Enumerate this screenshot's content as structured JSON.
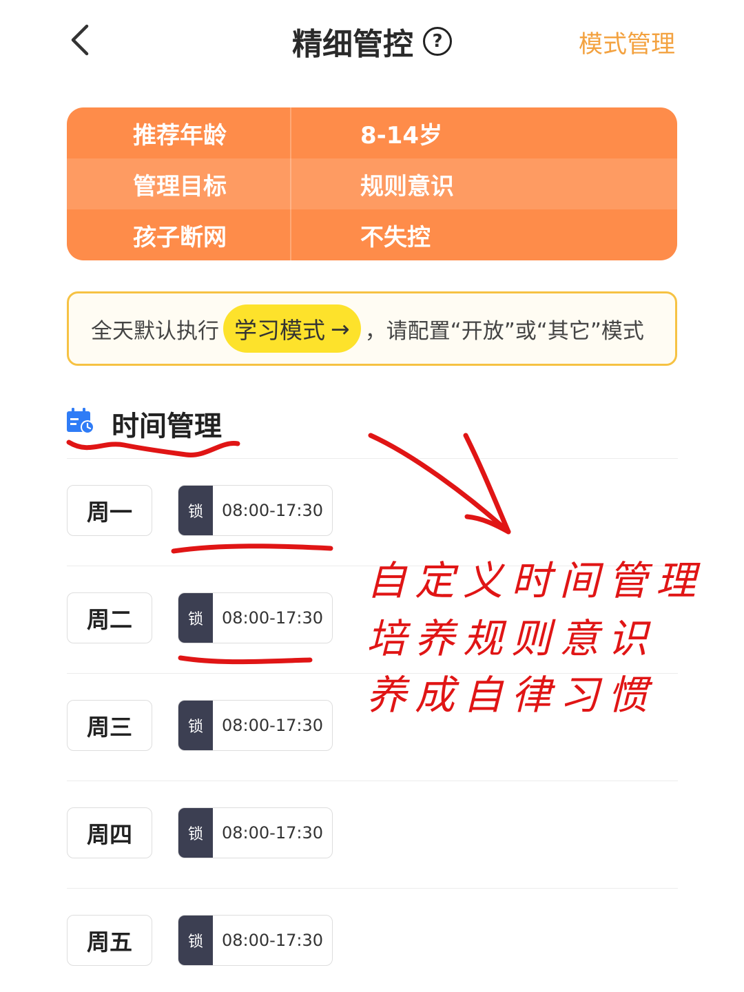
{
  "header": {
    "title": "精细管控",
    "help_glyph": "?",
    "action_label": "模式管理",
    "accent_color": "#f3a240"
  },
  "info_table": {
    "rows": [
      {
        "key": "推荐年龄",
        "value": "8-14岁"
      },
      {
        "key": "管理目标",
        "value": "规则意识"
      },
      {
        "key": "孩子断网",
        "value": "不失控"
      }
    ],
    "colors": [
      "#fe8c4a",
      "#fe9b62",
      "#fe8c4a"
    ]
  },
  "notice": {
    "prefix": "全天默认执行",
    "pill_label": "学习模式",
    "pill_arrow": "→",
    "suffix": "，请配置“开放”或“其它”模式"
  },
  "time_section": {
    "title": "时间管理",
    "icon": "calendar-clock-icon",
    "schedule": [
      {
        "day": "周一",
        "lock": "锁",
        "time": "08:00-17:30"
      },
      {
        "day": "周二",
        "lock": "锁",
        "time": "08:00-17:30"
      },
      {
        "day": "周三",
        "lock": "锁",
        "time": "08:00-17:30"
      },
      {
        "day": "周四",
        "lock": "锁",
        "time": "08:00-17:30"
      },
      {
        "day": "周五",
        "lock": "锁",
        "time": "08:00-17:30"
      }
    ]
  },
  "annotation": {
    "lines": [
      "自定义时间管理",
      "培养规则意识",
      "养成自律习惯"
    ],
    "color": "#e01515"
  }
}
